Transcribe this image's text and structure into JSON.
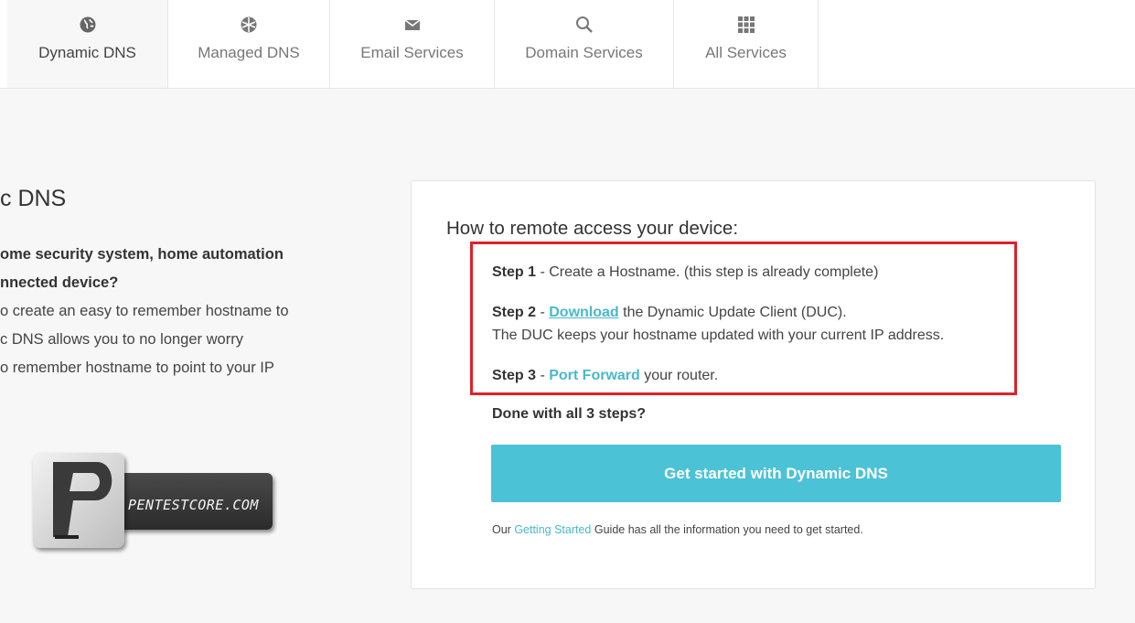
{
  "nav": {
    "tabs": [
      {
        "label": "Dynamic DNS",
        "icon": "globe-icon",
        "active": true
      },
      {
        "label": "Managed DNS",
        "icon": "network-globe-icon",
        "active": false
      },
      {
        "label": "Email Services",
        "icon": "envelope-icon",
        "active": false
      },
      {
        "label": "Domain Services",
        "icon": "search-icon",
        "active": false
      },
      {
        "label": "All Services",
        "icon": "grid-icon",
        "active": false
      }
    ]
  },
  "left": {
    "title": "c DNS",
    "lines": [
      "ome security system, home automation",
      "nnected device?",
      "o create an easy to remember hostname to",
      "c DNS allows you to no longer worry",
      "o remember hostname to point to your IP"
    ]
  },
  "logo": {
    "text": "PENTESTCORE.COM",
    "letter": "P"
  },
  "card": {
    "title": "How to remote access your device:",
    "step1": {
      "label": "Step 1",
      "text": " - Create a Hostname. (this step is already complete)"
    },
    "step2": {
      "label": "Step 2",
      "sep": " - ",
      "link": "Download",
      "text": " the Dynamic Update Client (DUC).",
      "text2": "The DUC keeps your hostname updated with your current IP address."
    },
    "step3": {
      "label": "Step 3",
      "sep": " - ",
      "link": "Port Forward",
      "text": " your router."
    },
    "done": "Done with all 3 steps?",
    "cta": "Get started with Dynamic DNS",
    "guide": {
      "prefix": "Our ",
      "link": "Getting Started",
      "suffix": " Guide has all the information you need to get started."
    }
  },
  "colors": {
    "accent": "#4cc2d6",
    "link": "#4ab8cc",
    "highlight": "#e0202a"
  }
}
